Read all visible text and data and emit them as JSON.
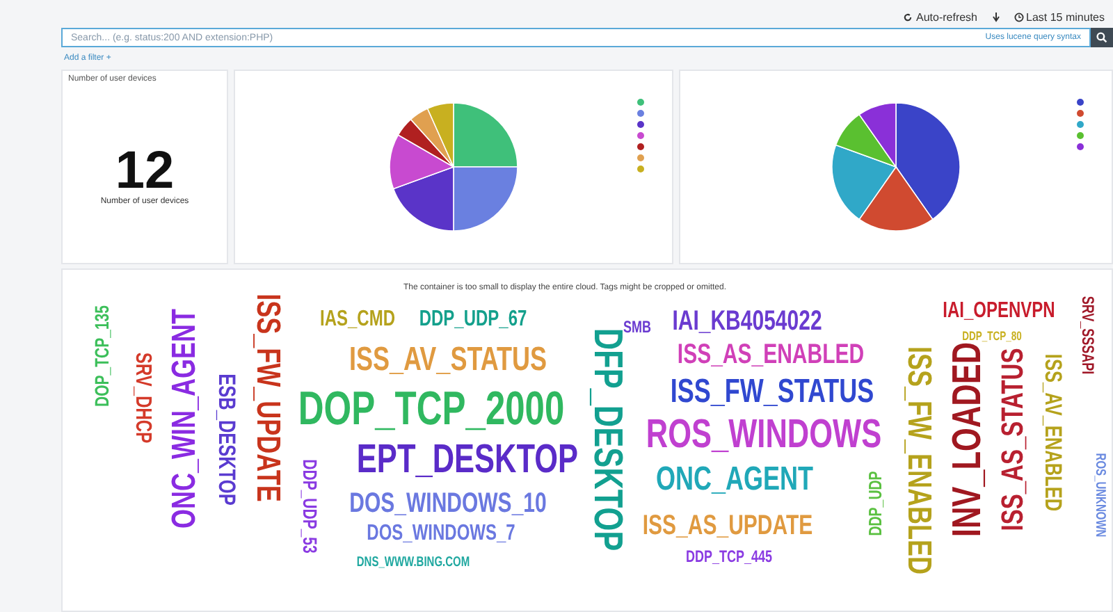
{
  "top_bar": {
    "auto_refresh": "Auto-refresh",
    "time_range": "Last 15 minutes"
  },
  "search": {
    "placeholder": "Search... (e.g. status:200 AND extension:PHP)",
    "hint": "Uses lucene query syntax"
  },
  "add_filter": "Add a filter +",
  "metric_panel": {
    "title": "Number of user devices",
    "value": "12",
    "caption": "Number of user devices"
  },
  "word_cloud": {
    "message": "The container is too small to display the entire cloud. Tags might be cropped or omitted.",
    "words": [
      {
        "text": "DOP_TCP_135",
        "color": "#3cbf5a"
      },
      {
        "text": "SRV_DHCP",
        "color": "#d43a2a"
      },
      {
        "text": "ONC_WIN_AGENT",
        "color": "#8a2be2"
      },
      {
        "text": "ESB_DESKTOP",
        "color": "#5a3bd0"
      },
      {
        "text": "ISS_FW_UPDATE",
        "color": "#c8341c"
      },
      {
        "text": "DDP_UDP_53",
        "color": "#8a3be2"
      },
      {
        "text": "IAS_CMD",
        "color": "#b5a21c"
      },
      {
        "text": "DDP_UDP_67",
        "color": "#14a08c"
      },
      {
        "text": "ISS_AV_STATUS",
        "color": "#e09a40"
      },
      {
        "text": "DOP_TCP_2000",
        "color": "#30b860"
      },
      {
        "text": "EPT_DESKTOP",
        "color": "#5a2bc8"
      },
      {
        "text": "DOS_WINDOWS_10",
        "color": "#6a78e0"
      },
      {
        "text": "DOS_WINDOWS_7",
        "color": "#6a78e0"
      },
      {
        "text": "DNS_WWW.BING.COM",
        "color": "#20a8a0"
      },
      {
        "text": "DFP_DESKTOP",
        "color": "#12a090"
      },
      {
        "text": "SMB",
        "color": "#6a3bd0"
      },
      {
        "text": "IAI_KB4054022",
        "color": "#6a3bd0"
      },
      {
        "text": "ISS_AS_ENABLED",
        "color": "#d040b8"
      },
      {
        "text": "ISS_FW_STATUS",
        "color": "#3048d0"
      },
      {
        "text": "ROS_WINDOWS",
        "color": "#c040d0"
      },
      {
        "text": "ONC_AGENT",
        "color": "#20a8b8"
      },
      {
        "text": "ISS_AS_UPDATE",
        "color": "#e09a40"
      },
      {
        "text": "DDP_TCP_445",
        "color": "#8a3be2"
      },
      {
        "text": "DDP_UDP",
        "color": "#5ac040"
      },
      {
        "text": "ISS_FW_ENABLED",
        "color": "#b5a21c"
      },
      {
        "text": "IAI_OPENVPN",
        "color": "#c81c2c"
      },
      {
        "text": "DDP_TCP_80",
        "color": "#c8b020"
      },
      {
        "text": "INV_LOADED",
        "color": "#a01820"
      },
      {
        "text": "ISS_AS_STATUS",
        "color": "#b82030"
      },
      {
        "text": "ISS_AV_ENABLED",
        "color": "#b5a21c"
      },
      {
        "text": "SRV_SSSAPI",
        "color": "#a01828"
      },
      {
        "text": "ROS_UNKNOWN",
        "color": "#6a8ae0"
      }
    ]
  }
}
